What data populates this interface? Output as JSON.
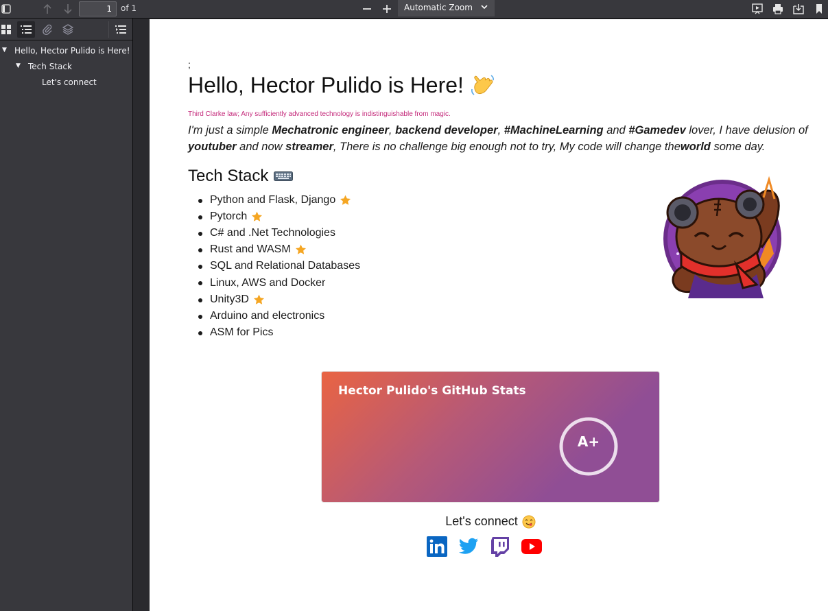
{
  "toolbar": {
    "page_number": "1",
    "page_count": "of 1",
    "zoom": "Automatic Zoom"
  },
  "outline": [
    {
      "label": "Hello, Hector Pulido is Here!",
      "level": 0,
      "expanded": true
    },
    {
      "label": "Tech Stack",
      "level": 1,
      "expanded": true
    },
    {
      "label": "Let's connect",
      "level": 2
    }
  ],
  "document": {
    "semicolon": ";",
    "title": "Hello, Hector Pulido is Here!",
    "quote": "Third Clarke law; Any sufficiently advanced technology is indistinguishable from magic.",
    "intro": {
      "t1": "I'm just a simple ",
      "b1": "Mechatronic engineer",
      "t2": ", ",
      "b2": "backend developer",
      "t3": ", ",
      "b3": "#MachineLearning",
      "t4": " and ",
      "b4": "#Gamedev",
      "t5": " lover, I have delusion of ",
      "b5": "youtuber",
      "t6": " and now ",
      "b6": "streamer",
      "t7": ", There is no challenge big enough not to try, My code will change the",
      "b7": "world",
      "t8": " some day."
    },
    "tech_stack_heading": "Tech Stack",
    "tech_stack": [
      {
        "label": "Python and Flask, Django",
        "starred": true
      },
      {
        "label": "Pytorch",
        "starred": true
      },
      {
        "label": "C# and .Net Technologies",
        "starred": false
      },
      {
        "label": "Rust and WASM",
        "starred": true
      },
      {
        "label": "SQL and Relational Databases",
        "starred": false
      },
      {
        "label": "Linux, AWS and Docker",
        "starred": false
      },
      {
        "label": "Unity3D",
        "starred": true
      },
      {
        "label": "Arduino and electronics",
        "starred": false
      },
      {
        "label": "ASM for Pics",
        "starred": false
      }
    ],
    "stats_card": {
      "title": "Hector Pulido's GitHub Stats",
      "rank": "A+"
    },
    "connect_heading": "Let's connect",
    "socials": [
      "linkedin-icon",
      "twitter-icon",
      "twitch-icon",
      "youtube-icon"
    ]
  },
  "colors": {
    "quote": "#c4297a",
    "star": "#f5a623",
    "linkedin": "#0a66c2",
    "twitter": "#1da1f2",
    "twitch": "#6441a5",
    "youtube": "#ff0000"
  }
}
